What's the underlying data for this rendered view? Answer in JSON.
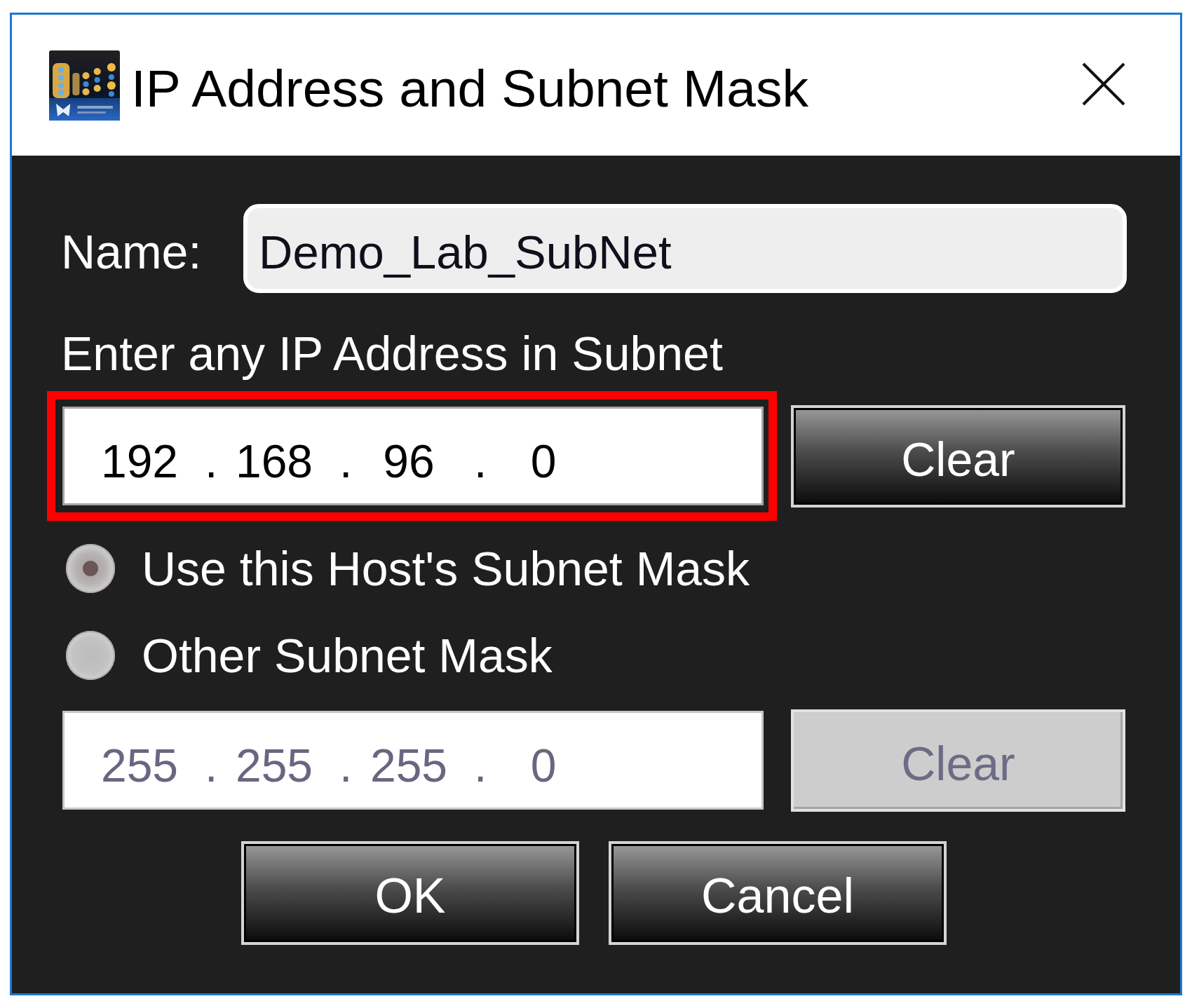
{
  "window": {
    "title": "IP Address and Subnet Mask"
  },
  "name": {
    "label": "Name:",
    "value": "Demo_Lab_SubNet"
  },
  "ip_address": {
    "label": "Enter any IP Address in Subnet",
    "highlighted": true,
    "disabled": false,
    "octets": [
      "192",
      "168",
      "96",
      "0"
    ],
    "separators": [
      ".",
      ".",
      "."
    ],
    "clear_button": {
      "label": "Clear",
      "disabled": false
    }
  },
  "mask_options": [
    {
      "label": "Use this Host's Subnet Mask",
      "selected": true
    },
    {
      "label": "Other Subnet Mask",
      "selected": false
    }
  ],
  "subnet_mask": {
    "disabled": true,
    "octets": [
      "255",
      "255",
      "255",
      "0"
    ],
    "separators": [
      ".",
      ".",
      "."
    ],
    "clear_button": {
      "label": "Clear",
      "disabled": true
    }
  },
  "buttons": [
    {
      "label": "OK"
    },
    {
      "label": "Cancel"
    }
  ]
}
